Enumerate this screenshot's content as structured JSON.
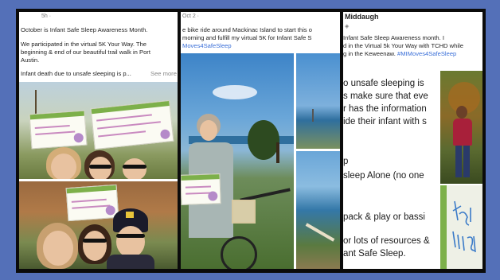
{
  "panel1": {
    "meta": "5h · ",
    "line1": "October is Infant Safe Sleep Awareness Month.",
    "line2": "We participated in the virtual 5K Your Way.  The",
    "line3": "beginning & end of our beautiful trail walk in Port",
    "line4": "Austin.",
    "line5": "Infant death due to unsafe sleeping is p...",
    "see_more": "See more"
  },
  "panel2": {
    "meta": "Oct 2 · ",
    "line1": "e bike ride around Mackinac Island to start this o",
    "line2": "morning and fulfill my virtual 5K for Infant Safe S",
    "line3": "Moves4SafeSleep"
  },
  "panel3": {
    "name": "Middaugh",
    "line1": "Infant Safe Sleep Awareness month. I",
    "line2": "d in the Virtual 5k Your Way with TCHD while",
    "line3": "g in the Keweenaw.",
    "hashtag": "#MIMoves4SafeSleep",
    "big1": "o unsafe sleeping is",
    "big2": "s make sure that eve",
    "big3": "r has the information",
    "big4": "ide their infant with s",
    "big5": "p",
    "big6": "sleep Alone (no one",
    "big7": "pack & play or bassi",
    "big8": "or lots of resources &",
    "big9": "ant Safe Sleep."
  }
}
